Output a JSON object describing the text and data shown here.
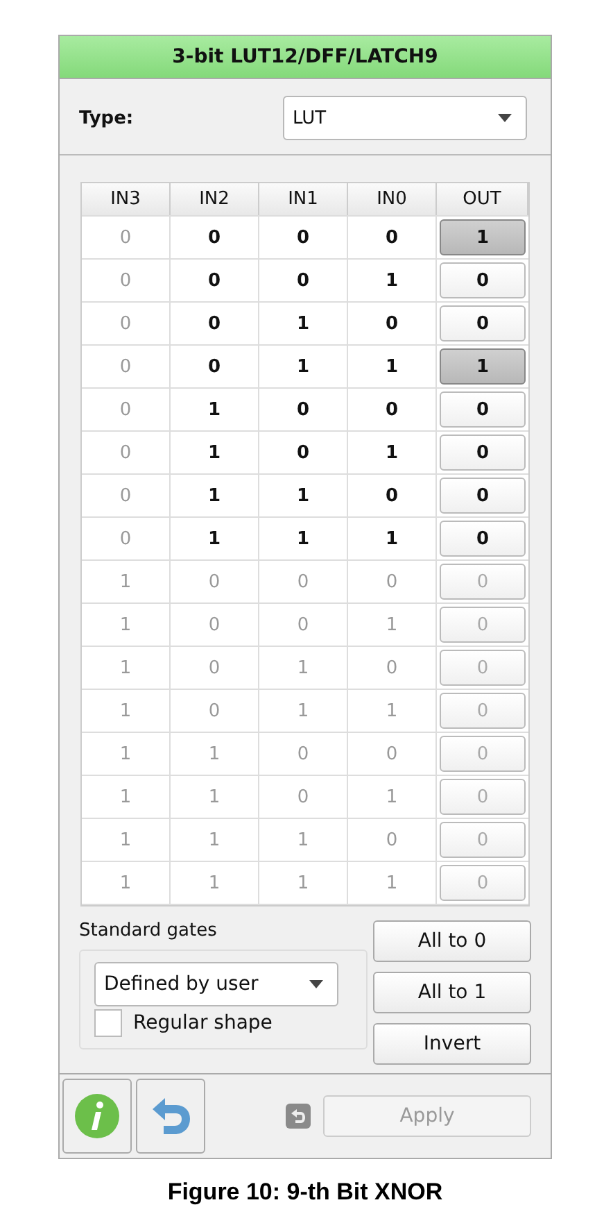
{
  "panel": {
    "title": "3-bit LUT12/DFF/LATCH9"
  },
  "type_field": {
    "label": "Type:",
    "value": "LUT"
  },
  "table": {
    "columns": [
      {
        "label": "IN3",
        "disabled": true
      },
      {
        "label": "IN2",
        "disabled": false
      },
      {
        "label": "IN1",
        "disabled": false
      },
      {
        "label": "IN0",
        "disabled": false
      },
      {
        "label": "OUT",
        "disabled": false
      }
    ],
    "rows": [
      {
        "inputs": [
          "0",
          "0",
          "0",
          "0"
        ],
        "out": "1",
        "selected": true,
        "disabled": false
      },
      {
        "inputs": [
          "0",
          "0",
          "0",
          "1"
        ],
        "out": "0",
        "selected": false,
        "disabled": false
      },
      {
        "inputs": [
          "0",
          "0",
          "1",
          "0"
        ],
        "out": "0",
        "selected": false,
        "disabled": false
      },
      {
        "inputs": [
          "0",
          "0",
          "1",
          "1"
        ],
        "out": "1",
        "selected": true,
        "disabled": false
      },
      {
        "inputs": [
          "0",
          "1",
          "0",
          "0"
        ],
        "out": "0",
        "selected": false,
        "disabled": false
      },
      {
        "inputs": [
          "0",
          "1",
          "0",
          "1"
        ],
        "out": "0",
        "selected": false,
        "disabled": false
      },
      {
        "inputs": [
          "0",
          "1",
          "1",
          "0"
        ],
        "out": "0",
        "selected": false,
        "disabled": false
      },
      {
        "inputs": [
          "0",
          "1",
          "1",
          "1"
        ],
        "out": "0",
        "selected": false,
        "disabled": false
      },
      {
        "inputs": [
          "1",
          "0",
          "0",
          "0"
        ],
        "out": "0",
        "selected": false,
        "disabled": true
      },
      {
        "inputs": [
          "1",
          "0",
          "0",
          "1"
        ],
        "out": "0",
        "selected": false,
        "disabled": true
      },
      {
        "inputs": [
          "1",
          "0",
          "1",
          "0"
        ],
        "out": "0",
        "selected": false,
        "disabled": true
      },
      {
        "inputs": [
          "1",
          "0",
          "1",
          "1"
        ],
        "out": "0",
        "selected": false,
        "disabled": true
      },
      {
        "inputs": [
          "1",
          "1",
          "0",
          "0"
        ],
        "out": "0",
        "selected": false,
        "disabled": true
      },
      {
        "inputs": [
          "1",
          "1",
          "0",
          "1"
        ],
        "out": "0",
        "selected": false,
        "disabled": true
      },
      {
        "inputs": [
          "1",
          "1",
          "1",
          "0"
        ],
        "out": "0",
        "selected": false,
        "disabled": true
      },
      {
        "inputs": [
          "1",
          "1",
          "1",
          "1"
        ],
        "out": "0",
        "selected": false,
        "disabled": true
      }
    ]
  },
  "standard_gates": {
    "label": "Standard gates",
    "value": "Defined by user",
    "regular_shape": {
      "label": "Regular shape",
      "checked": false
    }
  },
  "buttons": [
    "All to 0",
    "All to 1",
    "Invert"
  ],
  "apply_button": {
    "label": "Apply",
    "disabled": true
  },
  "caption": "Figure 10: 9-th Bit XNOR"
}
